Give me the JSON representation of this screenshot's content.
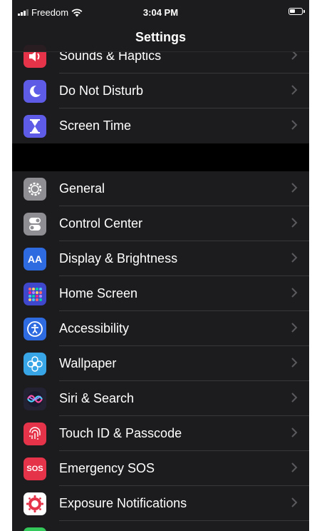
{
  "status_bar": {
    "carrier": "Freedom",
    "time": "3:04 PM"
  },
  "nav": {
    "title": "Settings"
  },
  "groups": [
    {
      "items": [
        {
          "label": "Sounds & Haptics",
          "icon": "speaker-icon",
          "color": "#e5334a"
        },
        {
          "label": "Do Not Disturb",
          "icon": "moon-icon",
          "color": "#5e5ce6"
        },
        {
          "label": "Screen Time",
          "icon": "hourglass-icon",
          "color": "#5e5ce6"
        }
      ]
    },
    {
      "items": [
        {
          "label": "General",
          "icon": "gear-icon",
          "color": "#8e8e93"
        },
        {
          "label": "Control Center",
          "icon": "toggles-icon",
          "color": "#8e8e93"
        },
        {
          "label": "Display & Brightness",
          "icon": "text-size-icon",
          "icon_text": "AA",
          "color": "#2f6be0"
        },
        {
          "label": "Home Screen",
          "icon": "app-grid-icon",
          "color": "#3f48cc"
        },
        {
          "label": "Accessibility",
          "icon": "accessibility-icon",
          "color": "#2f6be0"
        },
        {
          "label": "Wallpaper",
          "icon": "flower-icon",
          "color": "#37a5e6"
        },
        {
          "label": "Siri & Search",
          "icon": "siri-icon",
          "color": "#222233"
        },
        {
          "label": "Touch ID & Passcode",
          "icon": "fingerprint-icon",
          "color": "#e5334a"
        },
        {
          "label": "Emergency SOS",
          "icon": "sos-icon",
          "icon_text": "SOS",
          "color": "#e5334a"
        },
        {
          "label": "Exposure Notifications",
          "icon": "exposure-icon",
          "color": "#ffffff"
        }
      ]
    }
  ]
}
